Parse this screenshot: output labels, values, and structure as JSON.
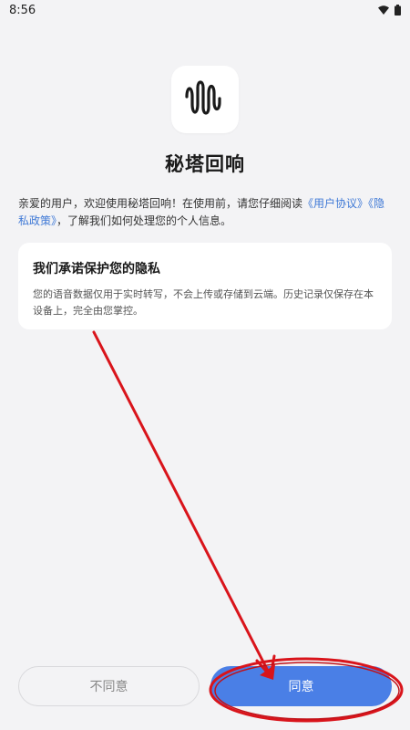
{
  "status_bar": {
    "time": "8:56",
    "icons": [
      "wifi-icon",
      "battery-icon"
    ]
  },
  "app": {
    "icon": "audio-wave-icon",
    "title": "秘塔回响"
  },
  "intro": {
    "text_before": "亲爱的用户，欢迎使用秘塔回响！在使用前，请您仔细阅读",
    "user_agreement_link": "《用户协议》",
    "privacy_policy_link": "《隐私政策》",
    "text_after": "，了解我们如何处理您的个人信息。"
  },
  "privacy_card": {
    "title": "我们承诺保护您的隐私",
    "body": "您的语音数据仅用于实时转写，不会上传或存储到云端。历史记录仅保存在本设备上，完全由您掌控。"
  },
  "buttons": {
    "decline_label": "不同意",
    "agree_label": "同意"
  },
  "colors": {
    "accent": "#4a7fe6",
    "link": "#3f79d6",
    "background": "#f3f3f5",
    "annotation": "#d9141b"
  }
}
